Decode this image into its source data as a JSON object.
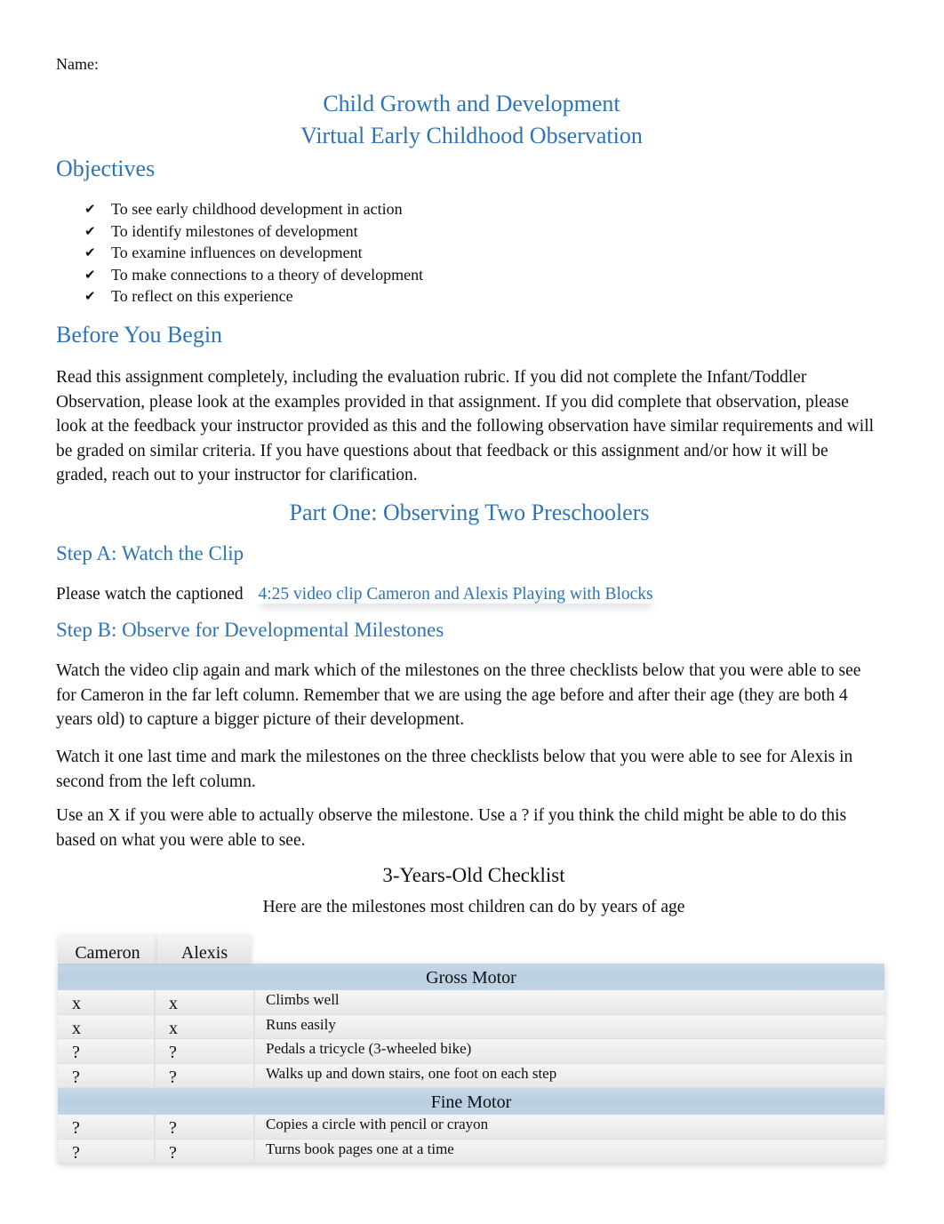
{
  "name_label": "Name:",
  "title_line1": "Child Growth and Development",
  "title_line2": "Virtual Early Childhood Observation",
  "objectives": {
    "heading": "Objectives",
    "bullet_icon": "checkmark-icon",
    "bullet_glyph": "✔",
    "items": [
      "To see early childhood development in action",
      "To identify milestones of development",
      "To examine influences on development",
      "To make connections to a theory of development",
      "To reflect on this experience"
    ]
  },
  "before_you_begin": {
    "heading": "Before You Begin",
    "text": "Read this assignment completely, including the evaluation rubric. If you did not complete the Infant/Toddler Observation, please look at the examples provided in that assignment. If you did complete that observation, please look at the feedback your instructor provided as this and the following observation have similar requirements and will be graded on similar criteria. If you have questions about that feedback or this assignment and/or how it will be graded, reach out to your instructor for clarification."
  },
  "part_one": {
    "heading": "Part One: Observing Two Preschoolers",
    "step_a": {
      "heading": "Step A: Watch the Clip",
      "text": "Please watch the captioned",
      "link": "4:25 video clip Cameron and Alexis Playing with Blocks"
    },
    "step_b": {
      "heading": "Step B: Observe for Developmental Milestones",
      "paragraphs": [
        "Watch the video clip again and mark which of the milestones on the three checklists below that you were able to see for Cameron in the far left column. Remember that we are using the age before and after their age (they are both 4 years old) to capture a bigger picture of their development.",
        "Watch it one last time and mark the milestones on the three checklists below that you were able to see for Alexis in second from the left column.",
        "Use an X if you were able to actually observe the milestone. Use a ? if you think the child might be able to do this based on what you were able to see."
      ]
    }
  },
  "checklist": {
    "title": "3-Years-Old Checklist",
    "subtitle": "Here are the milestones most children can do by years of age",
    "columns": [
      "Cameron",
      "Alexis"
    ],
    "sections": [
      {
        "name": "Gross Motor",
        "rows": [
          {
            "cameron": "x",
            "alexis": "x",
            "milestone": "Climbs well"
          },
          {
            "cameron": "x",
            "alexis": "x",
            "milestone": "Runs easily"
          },
          {
            "cameron": "?",
            "alexis": "?",
            "milestone": "Pedals a tricycle (3-wheeled bike)"
          },
          {
            "cameron": "?",
            "alexis": "?",
            "milestone": "Walks up and down stairs, one foot on each step"
          }
        ]
      },
      {
        "name": "Fine Motor",
        "rows": [
          {
            "cameron": "?",
            "alexis": "?",
            "milestone": "Copies a circle with pencil or crayon"
          },
          {
            "cameron": "?",
            "alexis": "?",
            "milestone": "Turns book pages one at a time"
          }
        ]
      }
    ]
  },
  "colors": {
    "heading": "#2e74b5",
    "section_band": "#b8cfe2"
  }
}
